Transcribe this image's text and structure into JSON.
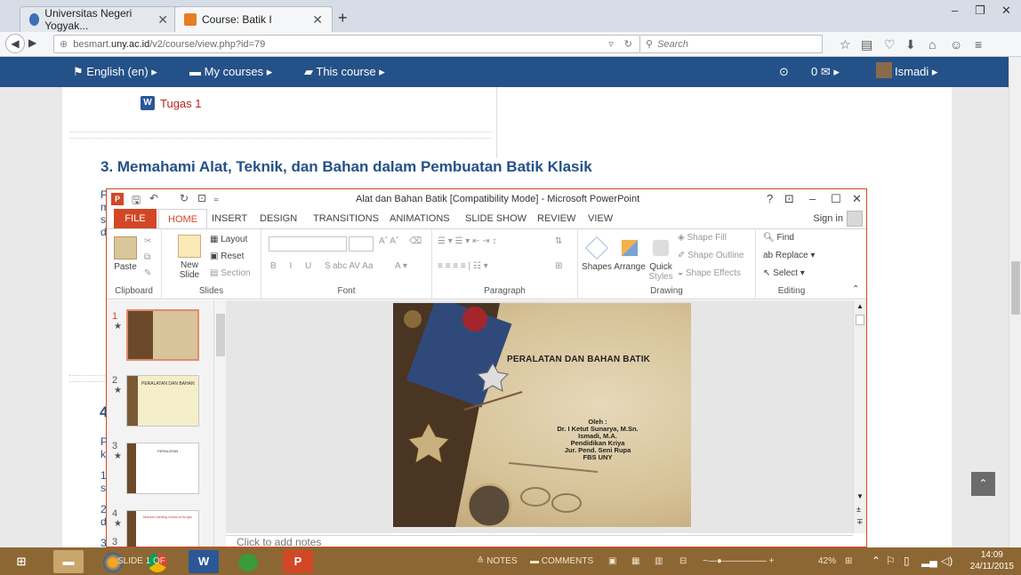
{
  "browser": {
    "tabs": [
      {
        "label": "Universitas Negeri Yogyak...",
        "active": false
      },
      {
        "label": "Course: Batik I",
        "active": true
      }
    ],
    "url_prefix": "besmart.",
    "url_domain": "uny.ac.id",
    "url_path": "/v2/course/view.php?id=79",
    "search_placeholder": "Search"
  },
  "moodle": {
    "menu": {
      "language": "English (en)",
      "my_courses": "My courses",
      "this_course": "This course",
      "messages_count": "0",
      "user": "Ismadi"
    },
    "activity": "Tugas 1",
    "section3_title": "3. Memahami Alat, Teknik, dan Bahan dalam Pembuatan Batik Klasik",
    "section4_number": "4",
    "stubs": [
      "P",
      "m",
      "s",
      "d",
      "P",
      "k",
      "1",
      "s",
      "2",
      "d",
      "3"
    ]
  },
  "powerpoint": {
    "window_title": "Alat dan Bahan Batik [Compatibility Mode] - Microsoft PowerPoint",
    "help": "?",
    "sign_in": "Sign in",
    "tabs": [
      "FILE",
      "HOME",
      "INSERT",
      "DESIGN",
      "TRANSITIONS",
      "ANIMATIONS",
      "SLIDE SHOW",
      "REVIEW",
      "VIEW"
    ],
    "groups": {
      "clipboard": "Clipboard",
      "slides": "Slides",
      "font": "Font",
      "paragraph": "Paragraph",
      "drawing": "Drawing",
      "editing": "Editing"
    },
    "buttons": {
      "paste": "Paste",
      "new_slide_1": "New",
      "new_slide_2": "Slide",
      "layout": "Layout",
      "reset": "Reset",
      "section": "Section",
      "shapes": "Shapes",
      "arrange": "Arrange",
      "quick_styles_1": "Quick",
      "quick_styles_2": "Styles",
      "shape_fill": "Shape Fill",
      "shape_outline": "Shape Outline",
      "shape_effects": "Shape Effects",
      "find": "Find",
      "replace": "Replace",
      "select": "Select"
    },
    "slide_numbers": [
      "1",
      "2",
      "3",
      "4",
      "3"
    ],
    "thumbnails": {
      "t2_title": "PERALATAN DAN BAHAN",
      "t3_title": "PERALATAN",
      "t4_title": "Macam canting menurut fungsi"
    },
    "slide": {
      "title": "PERALATAN DAN BAHAN BATIK",
      "credits": [
        "Oleh :",
        "Dr. I Ketut Sunarya, M.Sn.",
        "Ismadi, M.A.",
        "Pendidikan Kriya",
        "Jur. Pend. Seni Rupa",
        "FBS UNY"
      ]
    },
    "notes_placeholder": "Click to add notes"
  },
  "taskbar": {
    "status_slide": "SLIDE 1 OF",
    "status_notes": "NOTES",
    "status_comments": "COMMENTS",
    "zoom": "42%",
    "time": "14:09",
    "date": "24/11/2015"
  },
  "colors": {
    "moodle_bar": "#245188",
    "ppt_accent": "#d24726",
    "taskbar": "#8d6733"
  }
}
